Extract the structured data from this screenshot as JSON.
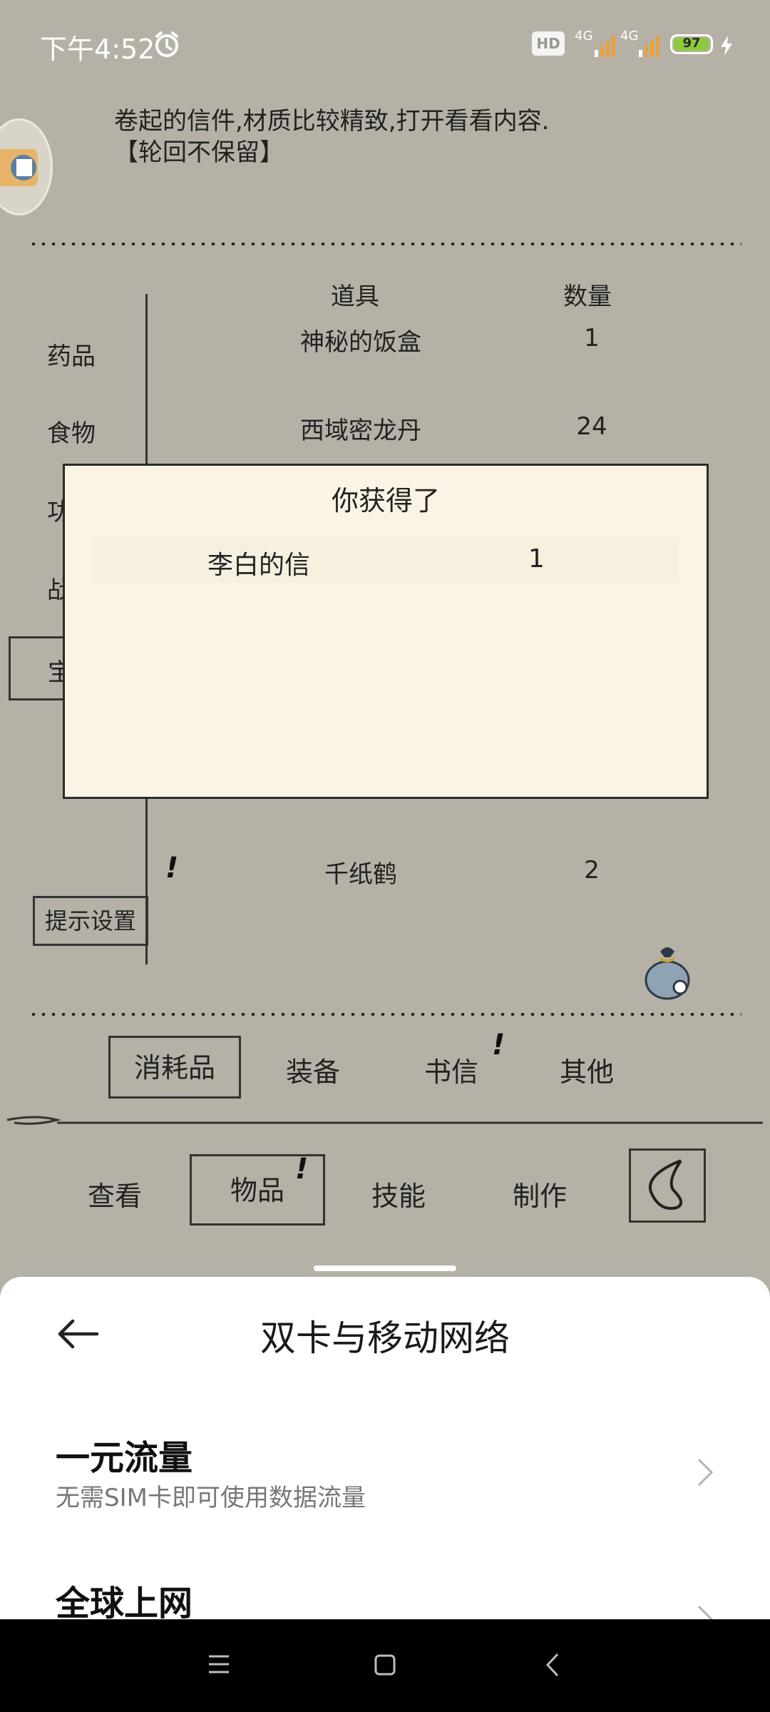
{
  "status_bar": {
    "time": "下午4:52",
    "hd_label": "HD",
    "net1": "4G",
    "net2": "4G",
    "battery": "97",
    "battery_level": 0.97
  },
  "game": {
    "description_line1": "卷起的信件,材质比较精致,打开看看内容.",
    "description_line2": "【轮回不保留】",
    "columns": {
      "item": "道具",
      "qty": "数量"
    },
    "categories": [
      "药品",
      "食物",
      "功",
      "战",
      "宝"
    ],
    "items": [
      {
        "name": "神秘的饭盒",
        "qty": "1"
      },
      {
        "name": "西域密龙丹",
        "qty": "24"
      },
      {
        "name": "千纸鹤",
        "qty": "2",
        "mark": "!"
      }
    ],
    "hint_button": "提示设置",
    "sub_tabs": [
      {
        "label": "消耗品",
        "selected": true
      },
      {
        "label": "装备"
      },
      {
        "label": "书信",
        "mark": "!"
      },
      {
        "label": "其他"
      }
    ],
    "main_tabs": [
      {
        "label": "查看"
      },
      {
        "label": "物品",
        "selected": true,
        "mark": "!"
      },
      {
        "label": "技能"
      },
      {
        "label": "制作"
      }
    ]
  },
  "dialog": {
    "title": "你获得了",
    "item": "李白的信",
    "qty": "1"
  },
  "sheet": {
    "title": "双卡与移动网络",
    "options": [
      {
        "title": "一元流量",
        "subtitle": "无需SIM卡即可使用数据流量"
      },
      {
        "title": "全球上网"
      }
    ]
  }
}
